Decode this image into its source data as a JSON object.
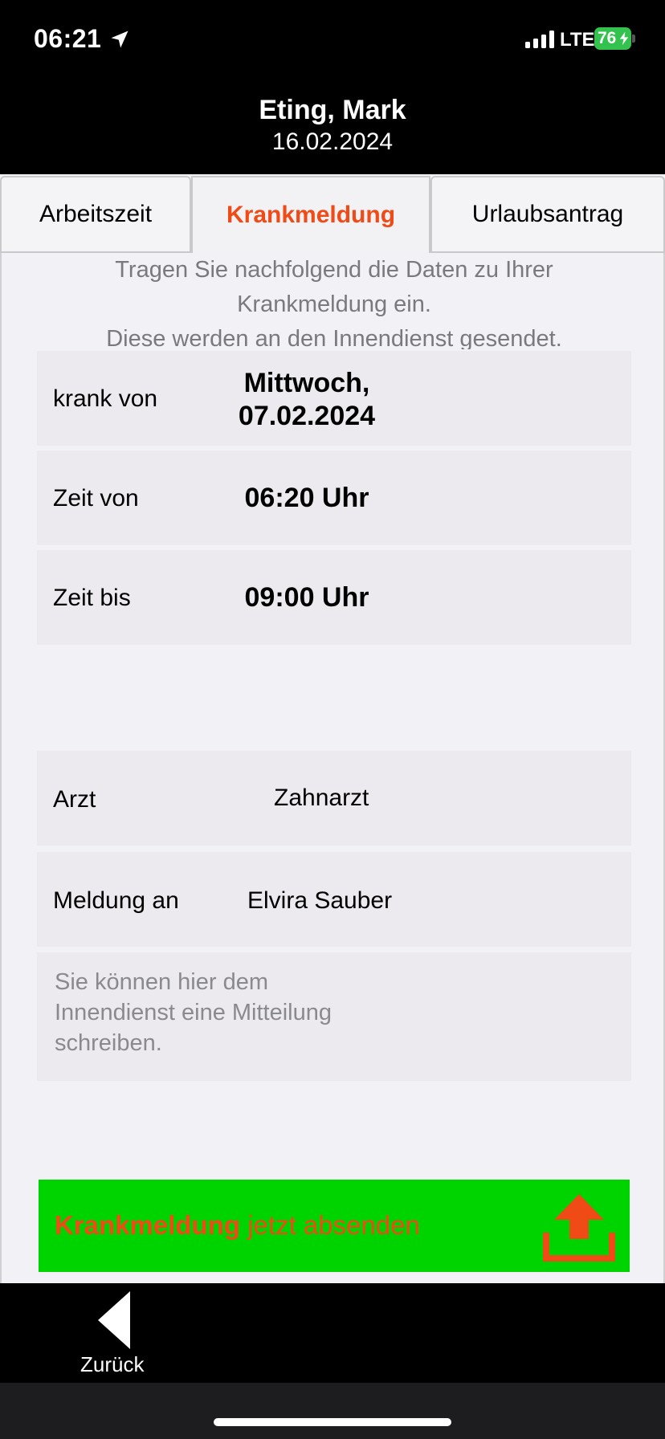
{
  "status_bar": {
    "time": "06:21",
    "network": "LTE",
    "battery_level": "76",
    "battery_color": "#32c24d"
  },
  "header": {
    "name": "Eting, Mark",
    "date": "16.02.2024"
  },
  "tabs": [
    {
      "label": "Arbeitszeit",
      "active": false
    },
    {
      "label": "Krankmeldung",
      "active": true
    },
    {
      "label": "Urlaubsantrag",
      "active": false
    }
  ],
  "intro": {
    "line1": "Tragen Sie nachfolgend die Daten zu Ihrer",
    "line2": "Krankmeldung ein.",
    "line3": "Diese werden an den Innendienst gesendet."
  },
  "form": {
    "krank_von": {
      "label": "krank von",
      "value_line1": "Mittwoch,",
      "value_line2": "07.02.2024"
    },
    "zeit_von": {
      "label": "Zeit von",
      "value": "06:20 Uhr"
    },
    "zeit_bis": {
      "label": "Zeit bis",
      "value": "09:00 Uhr"
    },
    "arzt": {
      "label": "Arzt",
      "value": "Zahnarzt"
    },
    "meldung_an": {
      "label": "Meldung an",
      "value": "Elvira Sauber"
    },
    "message_placeholder": "Sie können hier dem Innendienst eine Mitteilung schreiben."
  },
  "submit": {
    "label_strong": "Krankmeldung",
    "label_rest": " jetzt absenden",
    "background_color": "#00d400",
    "text_color": "#f04a17"
  },
  "bottom_nav": {
    "back_label": "Zurück"
  },
  "icons": {
    "location": "location-arrow-icon",
    "signal": "signal-bars-icon",
    "bolt": "charging-bolt-icon",
    "upload": "upload-icon",
    "back": "back-triangle-icon"
  }
}
